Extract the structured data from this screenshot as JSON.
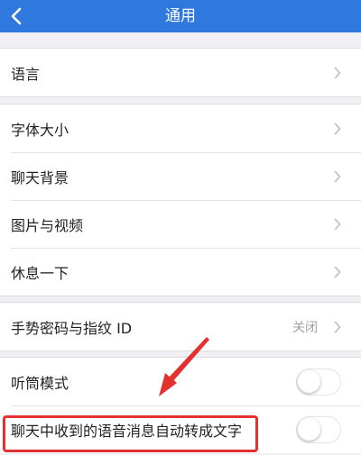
{
  "header": {
    "title": "通用",
    "back_icon": "chevron-left-icon",
    "background_color": "#2f78de"
  },
  "groups": [
    {
      "rows": [
        {
          "label": "语言"
        }
      ]
    },
    {
      "rows": [
        {
          "label": "字体大小"
        },
        {
          "label": "聊天背景"
        },
        {
          "label": "图片与视频"
        },
        {
          "label": "休息一下"
        }
      ]
    },
    {
      "rows": [
        {
          "label": "手势密码与指纹 ID",
          "value": "关闭"
        }
      ]
    },
    {
      "rows": [
        {
          "label": "听筒模式",
          "toggle_on": false
        },
        {
          "label": "聊天中收到的语音消息自动转成文字",
          "toggle_on": false
        }
      ]
    }
  ],
  "annotation": {
    "color": "#e53030"
  }
}
